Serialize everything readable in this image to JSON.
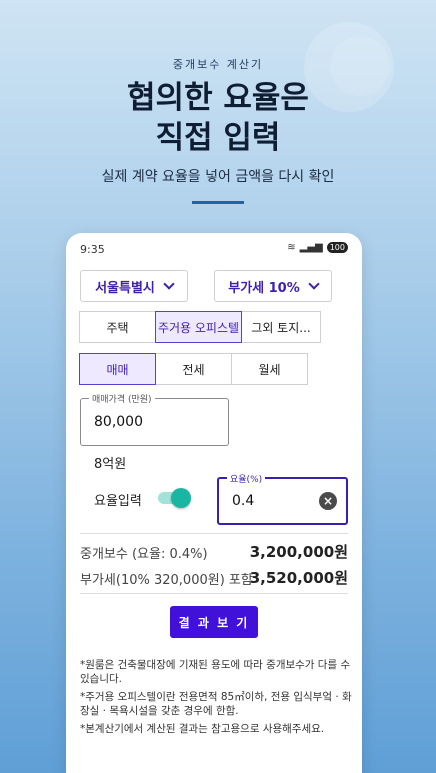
{
  "promo": {
    "eyebrow": "중개보수 계산기",
    "headline_line1": "협의한 요율은",
    "headline_line2": "직접 입력",
    "subline": "실제 계약 요율을 넣어 금액을 다시 확인"
  },
  "status_bar": {
    "time": "9:35",
    "battery": "100"
  },
  "selectors": {
    "region": "서울특별시",
    "vat": "부가세 10%"
  },
  "property_tabs": [
    {
      "label": "주택",
      "active": false
    },
    {
      "label": "주거용 오피스텔",
      "active": true
    },
    {
      "label": "그외 토지...",
      "active": false
    }
  ],
  "deal_tabs": [
    {
      "label": "매매",
      "active": true
    },
    {
      "label": "전세",
      "active": false
    },
    {
      "label": "월세",
      "active": false
    }
  ],
  "price_field": {
    "label": "매매가격 (만원)",
    "value": "80,000",
    "hint": "8억원"
  },
  "rate_input": {
    "toggle_label": "요율입력",
    "label": "요율(%)",
    "value": "0.4"
  },
  "results": {
    "fee_label": "중개보수 (요율: 0.4%)",
    "fee_value": "3,200,000원",
    "vat_label": "부가세(10% 320,000원) 포함",
    "vat_value": "3,520,000원"
  },
  "cta_label": "결 과 보 기",
  "notes": [
    "*원룸은 건축물대장에 기재된 용도에 따라 중개보수가 다를 수 있습니다.",
    "*주거용 오피스텔이란 전용면적 85㎡이하, 전용 입식부엌 · 화장실 · 목욕시설을 갖춘 경우에 한함.",
    "*본계산기에서 계산된 결과는 참고용으로 사용해주세요."
  ]
}
